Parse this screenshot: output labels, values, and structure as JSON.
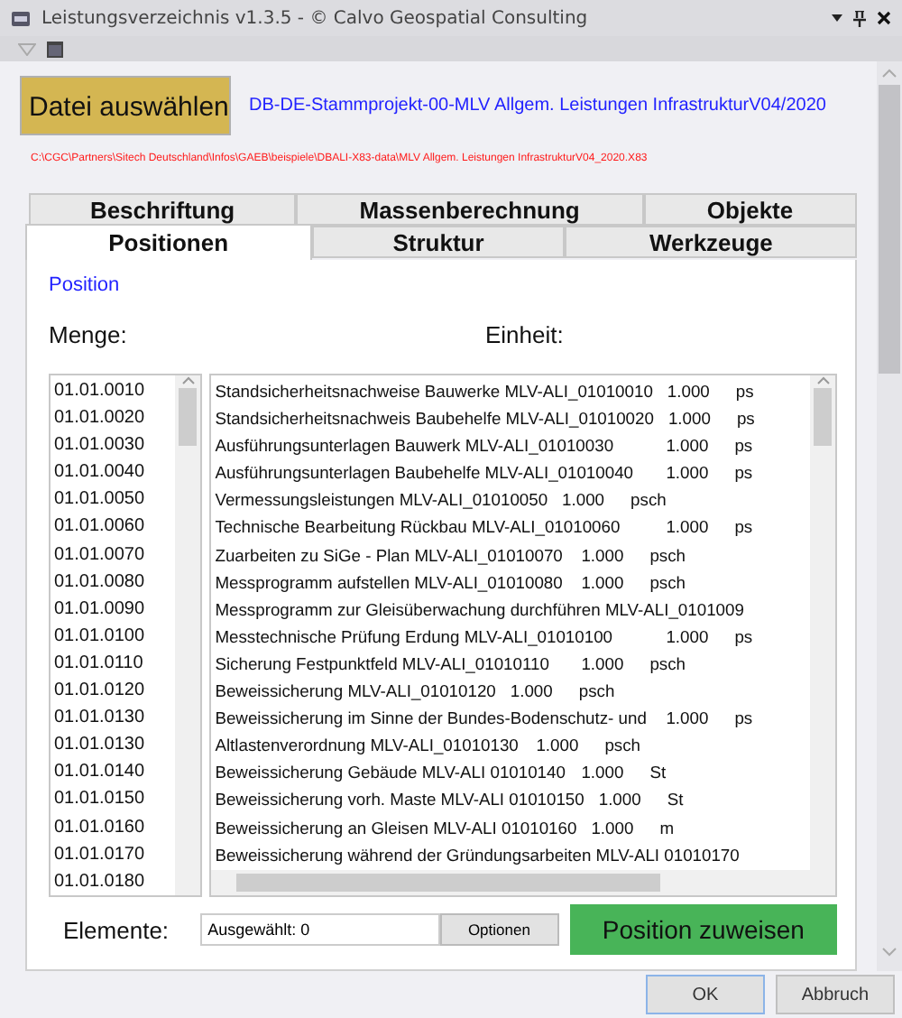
{
  "window": {
    "title": "Leistungsverzeichnis v1.3.5 - © Calvo Geospatial Consulting"
  },
  "file": {
    "button": "Datei auswählen",
    "project": "DB-DE-Stammprojekt-00-MLV Allgem. Leistungen InfrastrukturV04/2020",
    "path": "C:\\CGC\\Partners\\Sitech Deutschland\\Infos\\GAEB\\beispiele\\DBALI-X83-data\\MLV Allgem. Leistungen InfrastrukturV04_2020.X83"
  },
  "tab_rows": [
    [
      {
        "label": "Beschriftung",
        "selected": false
      },
      {
        "label": "Massenberechnung",
        "selected": false
      },
      {
        "label": "Objekte",
        "selected": false
      }
    ],
    [
      {
        "label": "Positionen",
        "selected": true
      },
      {
        "label": "Struktur",
        "selected": false
      },
      {
        "label": "Werkzeuge",
        "selected": false
      }
    ]
  ],
  "panel": {
    "heading": "Position",
    "quantity_label": "Menge:",
    "unit_label": "Einheit:"
  },
  "codes": [
    "01.01.0010",
    "01.01.0020",
    "01.01.0030",
    "01.01.0040",
    "01.01.0050",
    "01.01.0060",
    "01.01.0070",
    "01.01.0080",
    "01.01.0090",
    "01.01.0100",
    "01.01.0110",
    "01.01.0120",
    "01.01.0130",
    "01.01.0130",
    "01.01.0140",
    "01.01.0150",
    "01.01.0160",
    "01.01.0170",
    "01.01.0180"
  ],
  "positions": [
    {
      "description": "Standsicherheitsnachweise Bauwerke MLV-ALI_01010010",
      "quantity": "1.000",
      "unit": "ps"
    },
    {
      "description": "Standsicherheitsnachweis Baubehelfe MLV-ALI_01010020",
      "quantity": "1.000",
      "unit": "ps"
    },
    {
      "description": "Ausführungsunterlagen Bauwerk MLV-ALI_01010030",
      "quantity": "1.000",
      "unit": "ps"
    },
    {
      "description": "Ausführungsunterlagen Baubehelfe MLV-ALI_01010040",
      "quantity": "1.000",
      "unit": "ps"
    },
    {
      "description": "Vermessungsleistungen MLV-ALI_01010050",
      "quantity": "1.000",
      "unit": "psch"
    },
    {
      "description": "Technische Bearbeitung Rückbau MLV-ALI_01010060",
      "quantity": "1.000",
      "unit": "ps"
    },
    {
      "description": "Zuarbeiten zu SiGe - Plan MLV-ALI_01010070",
      "quantity": "1.000",
      "unit": "psch"
    },
    {
      "description": "Messprogramm aufstellen MLV-ALI_01010080",
      "quantity": "1.000",
      "unit": "psch"
    },
    {
      "description": "Messprogramm zur Gleisüberwachung durchführen MLV-ALI_0101009"
    },
    {
      "description": "Messtechnische Prüfung Erdung MLV-ALI_01010100",
      "quantity": "1.000",
      "unit": "ps"
    },
    {
      "description": "Sicherung Festpunktfeld MLV-ALI_01010110",
      "quantity": "1.000",
      "unit": "psch"
    },
    {
      "description": "Beweissicherung MLV-ALI_01010120",
      "quantity": "1.000",
      "unit": "psch"
    },
    {
      "description": "Beweissicherung im Sinne der Bundes-Bodenschutz- und",
      "quantity": "1.000",
      "unit": "ps"
    },
    {
      "description": "Altlastenverordnung MLV-ALI_01010130",
      "quantity": "1.000",
      "unit": "psch"
    },
    {
      "description": "Beweissicherung Gebäude MLV-ALI 01010140",
      "quantity": "1.000",
      "unit": "St"
    },
    {
      "description": "Beweissicherung vorh. Maste MLV-ALI 01010150",
      "quantity": "1.000",
      "unit": "St"
    },
    {
      "description": "Beweissicherung an Gleisen MLV-ALI 01010160",
      "quantity": "1.000",
      "unit": "m"
    },
    {
      "description": "Beweissicherung während der Gründungsarbeiten MLV-ALI 01010170"
    }
  ],
  "elements": {
    "label": "Elemente:",
    "value": "Ausgewählt: 0",
    "options_button": "Optionen",
    "assign_button": "Position zuweisen"
  },
  "buttons": [
    "OK",
    "Abbruch"
  ]
}
